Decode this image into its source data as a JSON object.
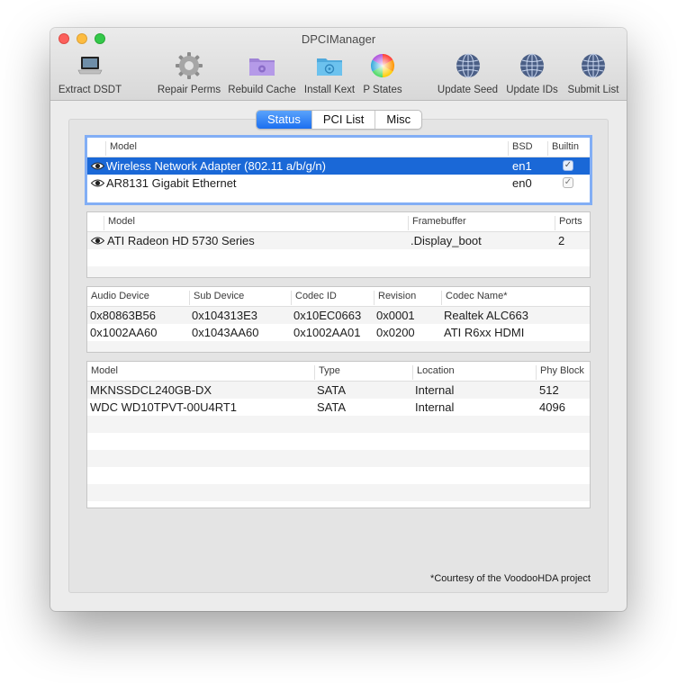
{
  "window": {
    "title": "DPCIManager"
  },
  "toolbar": {
    "extract": "Extract DSDT",
    "repair": "Repair Perms",
    "rebuild": "Rebuild Cache",
    "install": "Install Kext",
    "pstates": "P States",
    "update_seed": "Update Seed",
    "update_ids": "Update IDs",
    "submit": "Submit List"
  },
  "tabs": [
    "Status",
    "PCI List",
    "Misc"
  ],
  "selected_tab": "Status",
  "network": {
    "headers": [
      "Model",
      "BSD",
      "Builtin"
    ],
    "rows": [
      {
        "model": "Wireless Network Adapter (802.11 a/b/g/n)",
        "bsd": "en1",
        "builtin": "✓",
        "selected": true
      },
      {
        "model": "AR8131 Gigabit Ethernet",
        "bsd": "en0",
        "builtin": "✓",
        "selected": false
      }
    ]
  },
  "graphics": {
    "headers": [
      "Model",
      "Framebuffer",
      "Ports"
    ],
    "rows": [
      {
        "model": "ATI Radeon HD 5730 Series",
        "framebuffer": ".Display_boot",
        "ports": "2"
      }
    ]
  },
  "audio": {
    "headers": [
      "Audio Device",
      "Sub Device",
      "Codec ID",
      "Revision",
      "Codec Name*"
    ],
    "rows": [
      {
        "device": "0x80863B56",
        "sub": "0x104313E3",
        "codec": "0x10EC0663",
        "rev": "0x0001",
        "name": "Realtek ALC663"
      },
      {
        "device": "0x1002AA60",
        "sub": "0x1043AA60",
        "codec": "0x1002AA01",
        "rev": "0x0200",
        "name": "ATI R6xx HDMI"
      }
    ]
  },
  "storage": {
    "headers": [
      "Model",
      "Type",
      "Location",
      "Phy Block"
    ],
    "rows": [
      {
        "model": "MKNSSDCL240GB-DX",
        "type": "SATA",
        "location": "Internal",
        "block": "512"
      },
      {
        "model": "WDC WD10TPVT-00U4RT1",
        "type": "SATA",
        "location": "Internal",
        "block": "4096"
      }
    ]
  },
  "footnote": "*Courtesy of the VoodooHDA project",
  "colors": {
    "selection": "#1a68d7",
    "focus_ring": "#82aef5",
    "tab_active": "#2f80f4"
  }
}
